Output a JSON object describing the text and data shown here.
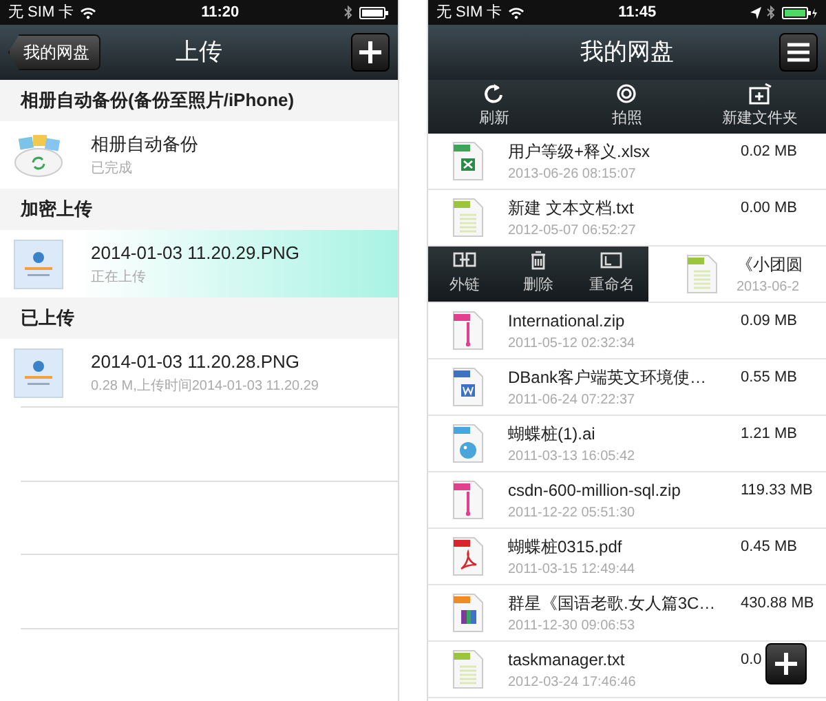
{
  "left_screen": {
    "status_bar": {
      "carrier": "无 SIM 卡",
      "time": "11:20",
      "location": false,
      "charging": false
    },
    "nav": {
      "back": "我的网盘",
      "title": "上传"
    },
    "sections": [
      {
        "title": "相册自动备份(备份至照片/iPhone)",
        "items": [
          {
            "kind": "cloud",
            "name": "相册自动备份",
            "detail": "已完成",
            "highlighted": false
          }
        ]
      },
      {
        "title": "加密上传",
        "items": [
          {
            "kind": "screenshot",
            "name": "2014-01-03 11.20.29.PNG",
            "detail": "正在上传",
            "highlighted": true
          }
        ]
      },
      {
        "title": "已上传",
        "items": [
          {
            "kind": "screenshot",
            "name": "2014-01-03 11.20.28.PNG",
            "detail": "0.28 M,上传时间2014-01-03 11.20.29",
            "highlighted": false
          }
        ]
      }
    ]
  },
  "right_screen": {
    "status_bar": {
      "carrier": "无 SIM 卡",
      "time": "11:45",
      "location": true,
      "charging": true
    },
    "nav": {
      "title": "我的网盘"
    },
    "toolbar": [
      {
        "kind": "refresh",
        "label": "刷新"
      },
      {
        "kind": "camera",
        "label": "拍照"
      },
      {
        "kind": "folder",
        "label": "新建文件夹"
      }
    ],
    "files": [
      {
        "kind": "xls",
        "name": "用户等级+释义.xlsx",
        "date": "2013-06-26 08:15:07",
        "size": "0.02 MB",
        "swiped": false
      },
      {
        "kind": "txt",
        "name": "新建 文本文档.txt",
        "date": "2012-05-07 06:52:27",
        "size": "0.00 MB",
        "swiped": false
      },
      {
        "kind": "txt",
        "name": "《小团圆",
        "date": "2013-06-2",
        "swiped": true,
        "actions": [
          {
            "kind": "link",
            "label": "外链"
          },
          {
            "kind": "trash",
            "label": "删除"
          },
          {
            "kind": "rename",
            "label": "重命名"
          }
        ]
      },
      {
        "kind": "zip",
        "name": "International.zip",
        "date": "2011-05-12 02:32:34",
        "size": "0.09 MB",
        "swiped": false
      },
      {
        "kind": "doc",
        "name": "DBank客户端英文环境使…",
        "date": "2011-06-24 07:22:37",
        "size": "0.55 MB",
        "swiped": false
      },
      {
        "kind": "ai",
        "name": "蝴蝶桩(1).ai",
        "date": "2011-03-13 16:05:42",
        "size": "1.21 MB",
        "swiped": false
      },
      {
        "kind": "zip",
        "name": "csdn-600-million-sql.zip",
        "date": "2011-12-22 05:51:30",
        "size": "119.33 MB",
        "swiped": false
      },
      {
        "kind": "pdf",
        "name": "蝴蝶桩0315.pdf",
        "date": "2011-03-15 12:49:44",
        "size": "0.45 MB",
        "swiped": false
      },
      {
        "kind": "rar",
        "name": "群星《国语老歌.女人篇3C…",
        "date": "2011-12-30 09:06:53",
        "size": "430.88 MB",
        "swiped": false
      },
      {
        "kind": "txt",
        "name": "taskmanager.txt",
        "date": "2012-03-24 17:46:46",
        "size": "0.0",
        "swiped": false
      }
    ]
  }
}
